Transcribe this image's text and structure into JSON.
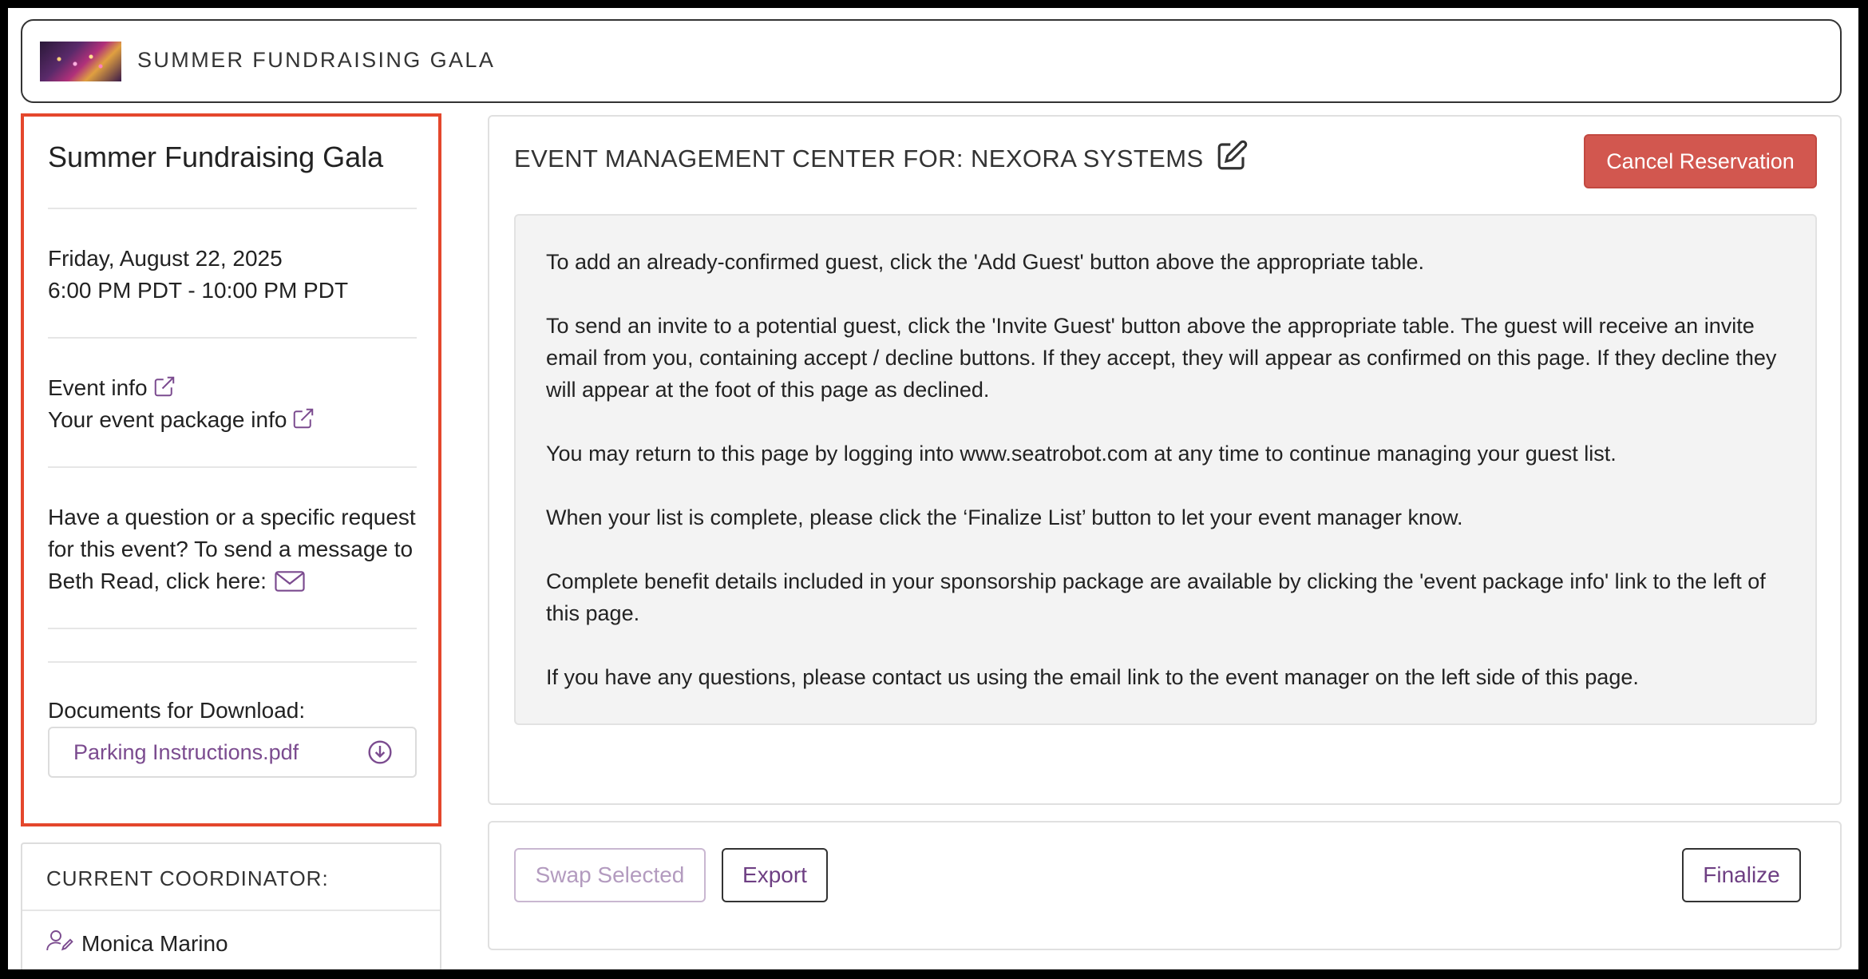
{
  "header": {
    "title": "SUMMER FUNDRAISING GALA"
  },
  "event": {
    "title": "Summer Fundraising Gala",
    "date": "Friday, August 22, 2025",
    "time": "6:00 PM PDT - 10:00 PM PDT",
    "event_info_link": "Event info",
    "package_info_link": "Your event package info",
    "question_line1": "Have a question or a specific request",
    "question_line2": "for this event? To send a message to",
    "question_line3": "Beth Read, click here:",
    "documents_label": "Documents for Download:",
    "documents": [
      {
        "name": "Parking Instructions.pdf"
      }
    ]
  },
  "coordinator": {
    "label": "CURRENT COORDINATOR:",
    "name": "Monica Marino"
  },
  "main": {
    "heading": "EVENT MANAGEMENT CENTER FOR: NEXORA SYSTEMS",
    "cancel_label": "Cancel Reservation",
    "instructions": [
      "To add an already-confirmed guest, click the 'Add Guest' button above the appropriate table.",
      "To send an invite to a potential guest, click the 'Invite Guest' button above the appropriate table. The guest will receive an invite email from you, containing accept / decline buttons. If they accept, they will appear as confirmed on this page. If they decline they will appear at the foot of this page as declined.",
      "You may return to this page by logging into www.seatrobot.com at any time to continue managing your guest list.",
      "When your list is complete, please click the ‘Finalize List’ button to let your event manager know.",
      "Complete benefit details included in your sponsorship package are available by clicking the 'event package info' link to the left of this page.",
      "If you have any questions, please contact us using the email link to the event manager on the left side of this page."
    ]
  },
  "actions": {
    "swap_label": "Swap Selected",
    "export_label": "Export",
    "finalize_label": "Finalize"
  },
  "colors": {
    "highlight_border": "#e4472c",
    "cancel_button": "#d2574f",
    "brand_purple": "#7b4b8f",
    "disabled_purple": "#b39bbf"
  },
  "icons": {
    "edit": "edit-icon",
    "external_link": "external-link-icon",
    "mail": "mail-icon",
    "download": "download-icon",
    "person": "person-edit-icon"
  }
}
